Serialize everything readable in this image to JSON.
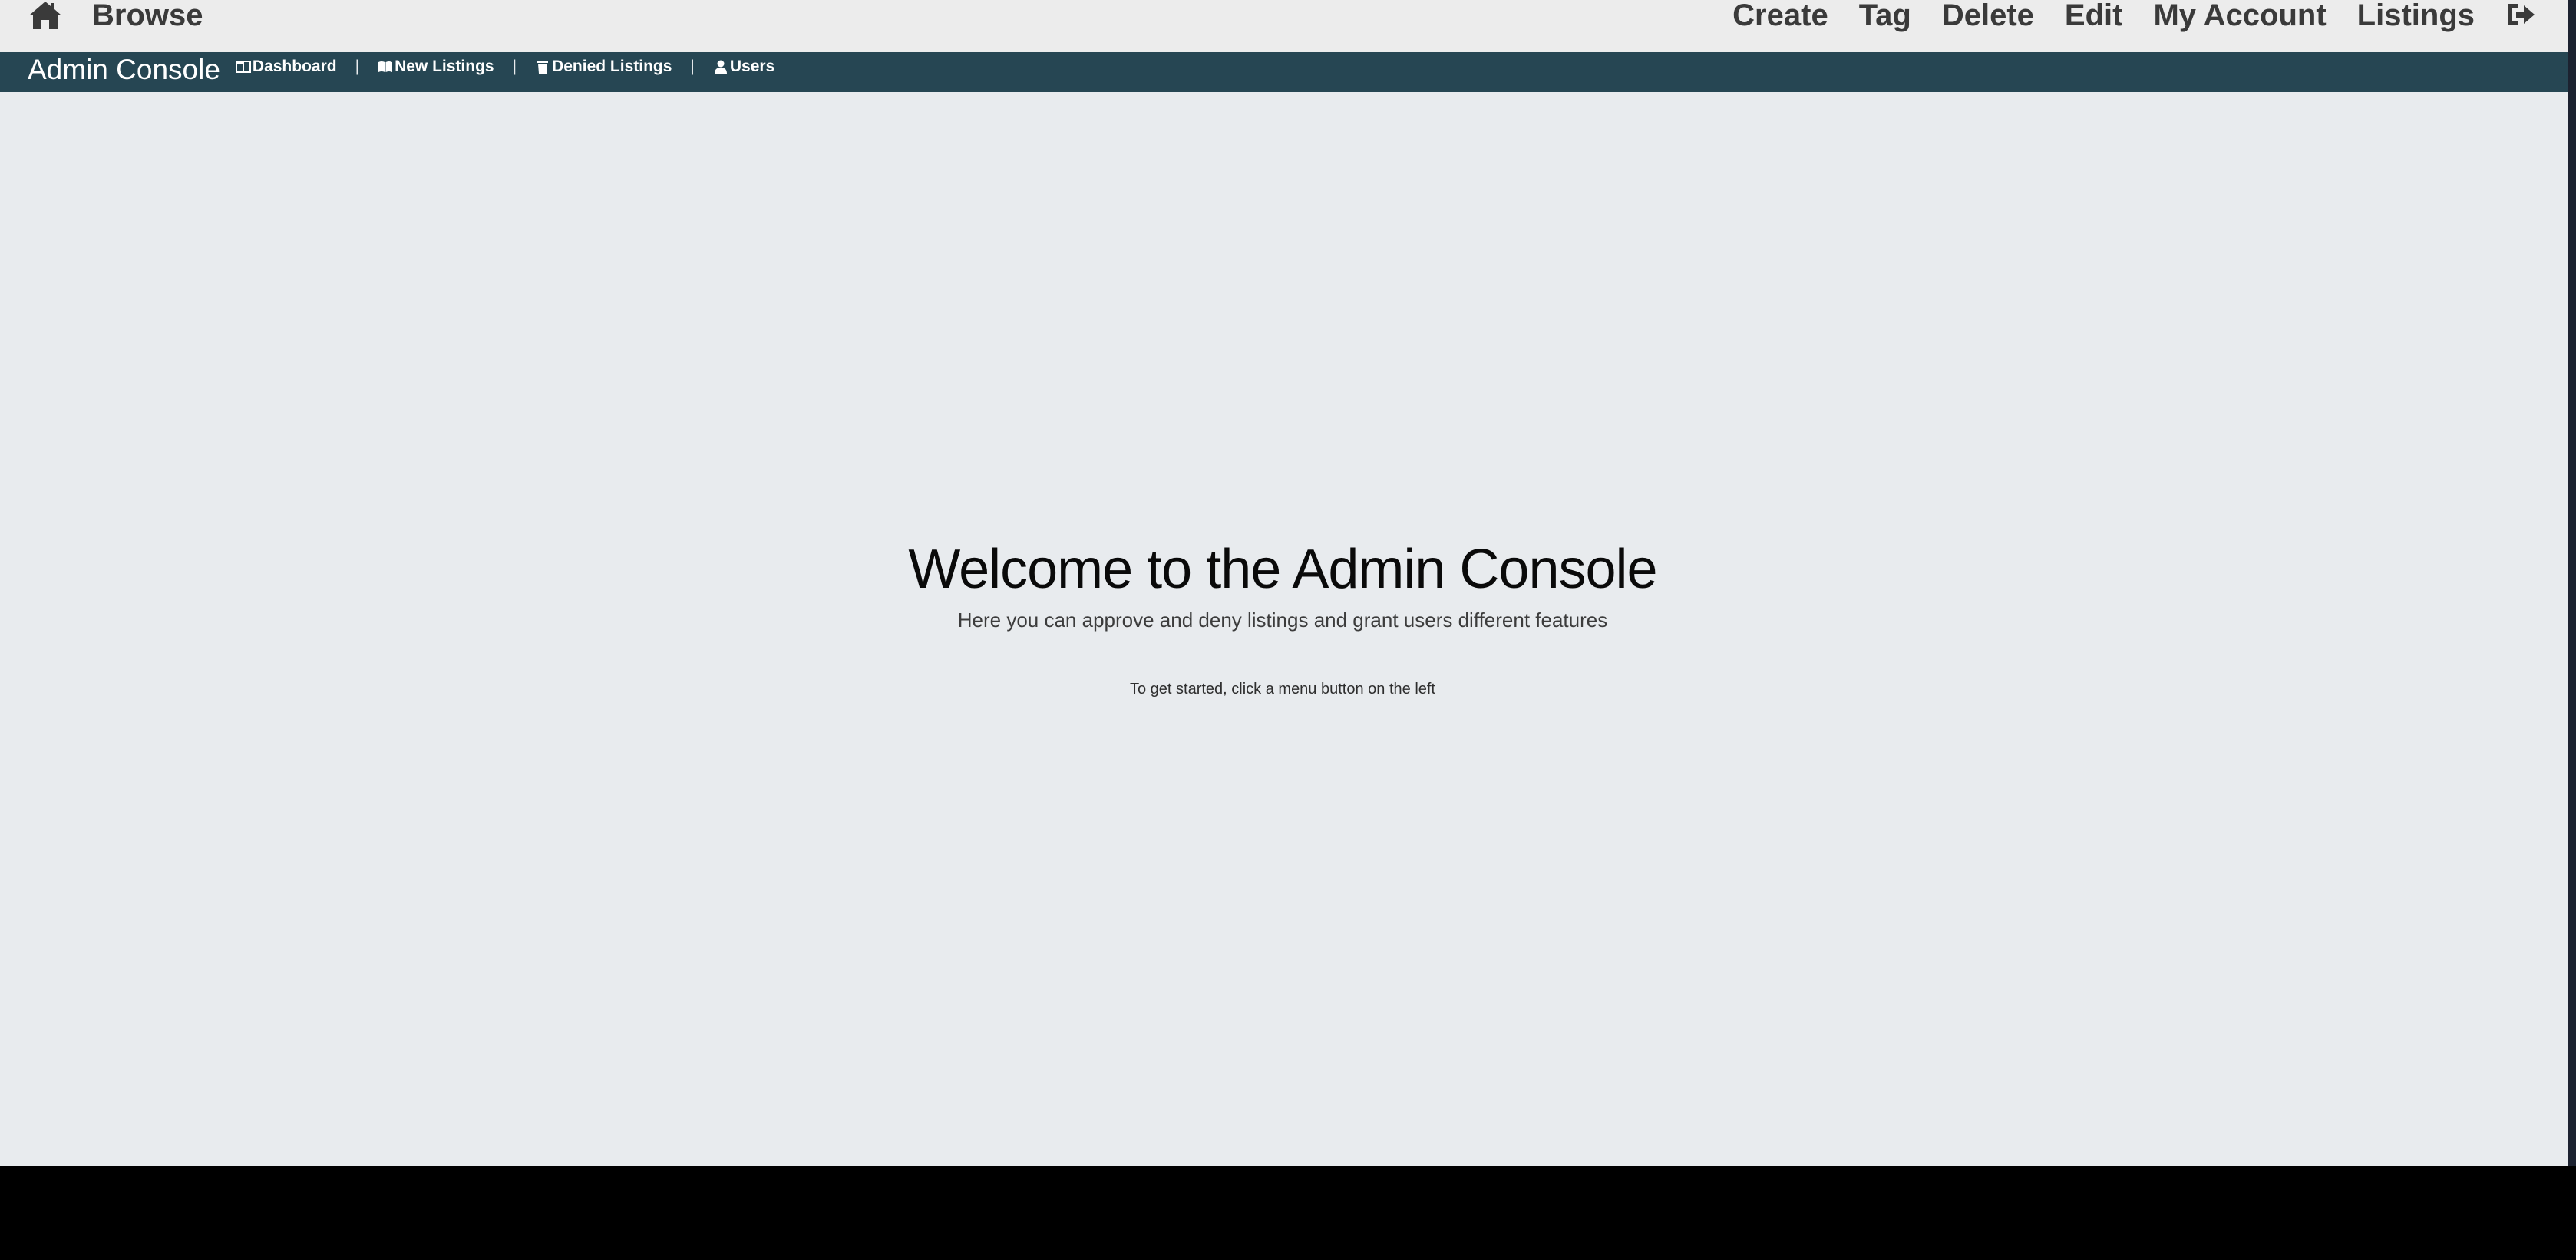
{
  "topnav": {
    "home_icon": "home-icon",
    "brand": "Browse",
    "links": [
      "Create",
      "Tag",
      "Delete",
      "Edit",
      "My Account",
      "Listings"
    ],
    "logout_icon": "sign-out-icon"
  },
  "adminbar": {
    "title": "Admin Console",
    "menu": [
      {
        "label": "Dashboard",
        "icon": "columns-icon"
      },
      {
        "label": "New Listings",
        "icon": "book-open-icon"
      },
      {
        "label": "Denied Listings",
        "icon": "trash-icon"
      },
      {
        "label": "Users",
        "icon": "user-icon"
      }
    ],
    "separator": "|"
  },
  "main": {
    "heading": "Welcome to the Admin Console",
    "subheading": "Here you can approve and deny listings and grant users different features",
    "hint": "To get started, click a menu button on the left"
  },
  "colors": {
    "topnav_bg": "#ececec",
    "adminbar_bg": "#264653",
    "content_bg": "#e8ebee",
    "outside_bg": "#000000"
  }
}
